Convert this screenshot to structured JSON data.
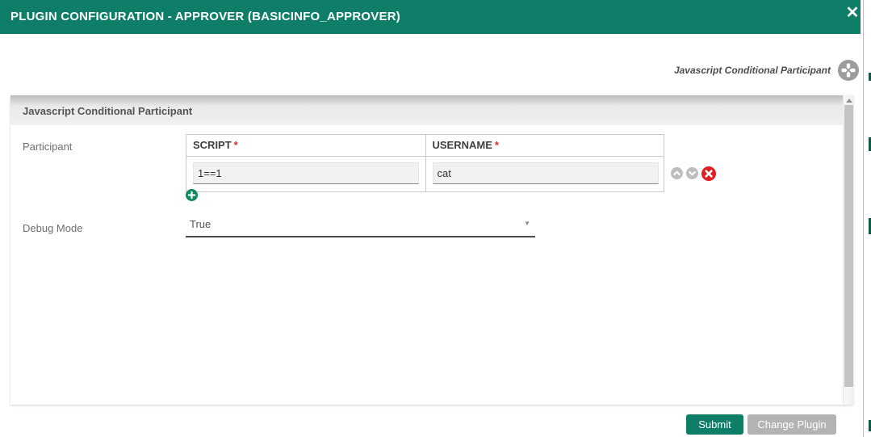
{
  "dialog": {
    "title": "PLUGIN CONFIGURATION - APPROVER (BASICINFO_APPROVER)",
    "plugin_name": "Javascript Conditional Participant"
  },
  "panel": {
    "section_title": "Javascript Conditional Participant"
  },
  "form": {
    "participant": {
      "label": "Participant",
      "columns": [
        {
          "label": "SCRIPT",
          "required": "*"
        },
        {
          "label": "USERNAME",
          "required": "*"
        }
      ],
      "rows": [
        {
          "cells": [
            "1==1",
            "cat"
          ]
        }
      ]
    },
    "debug_mode": {
      "label": "Debug Mode",
      "value": "True"
    }
  },
  "footer": {
    "submit": "Submit",
    "change_plugin": "Change Plugin"
  },
  "icons": {
    "close": "✕",
    "caret": "▼",
    "plugin_badge": "plugin-compress-icon",
    "move_up": "chevron-up-icon",
    "move_down": "chevron-down-icon",
    "delete": "delete-x-icon",
    "add": "plus-icon"
  },
  "colors": {
    "teal": "#0E7E68",
    "delete_red": "#E01E25",
    "add_green": "#0E8A60",
    "button_gray": "#B3B3B3"
  }
}
